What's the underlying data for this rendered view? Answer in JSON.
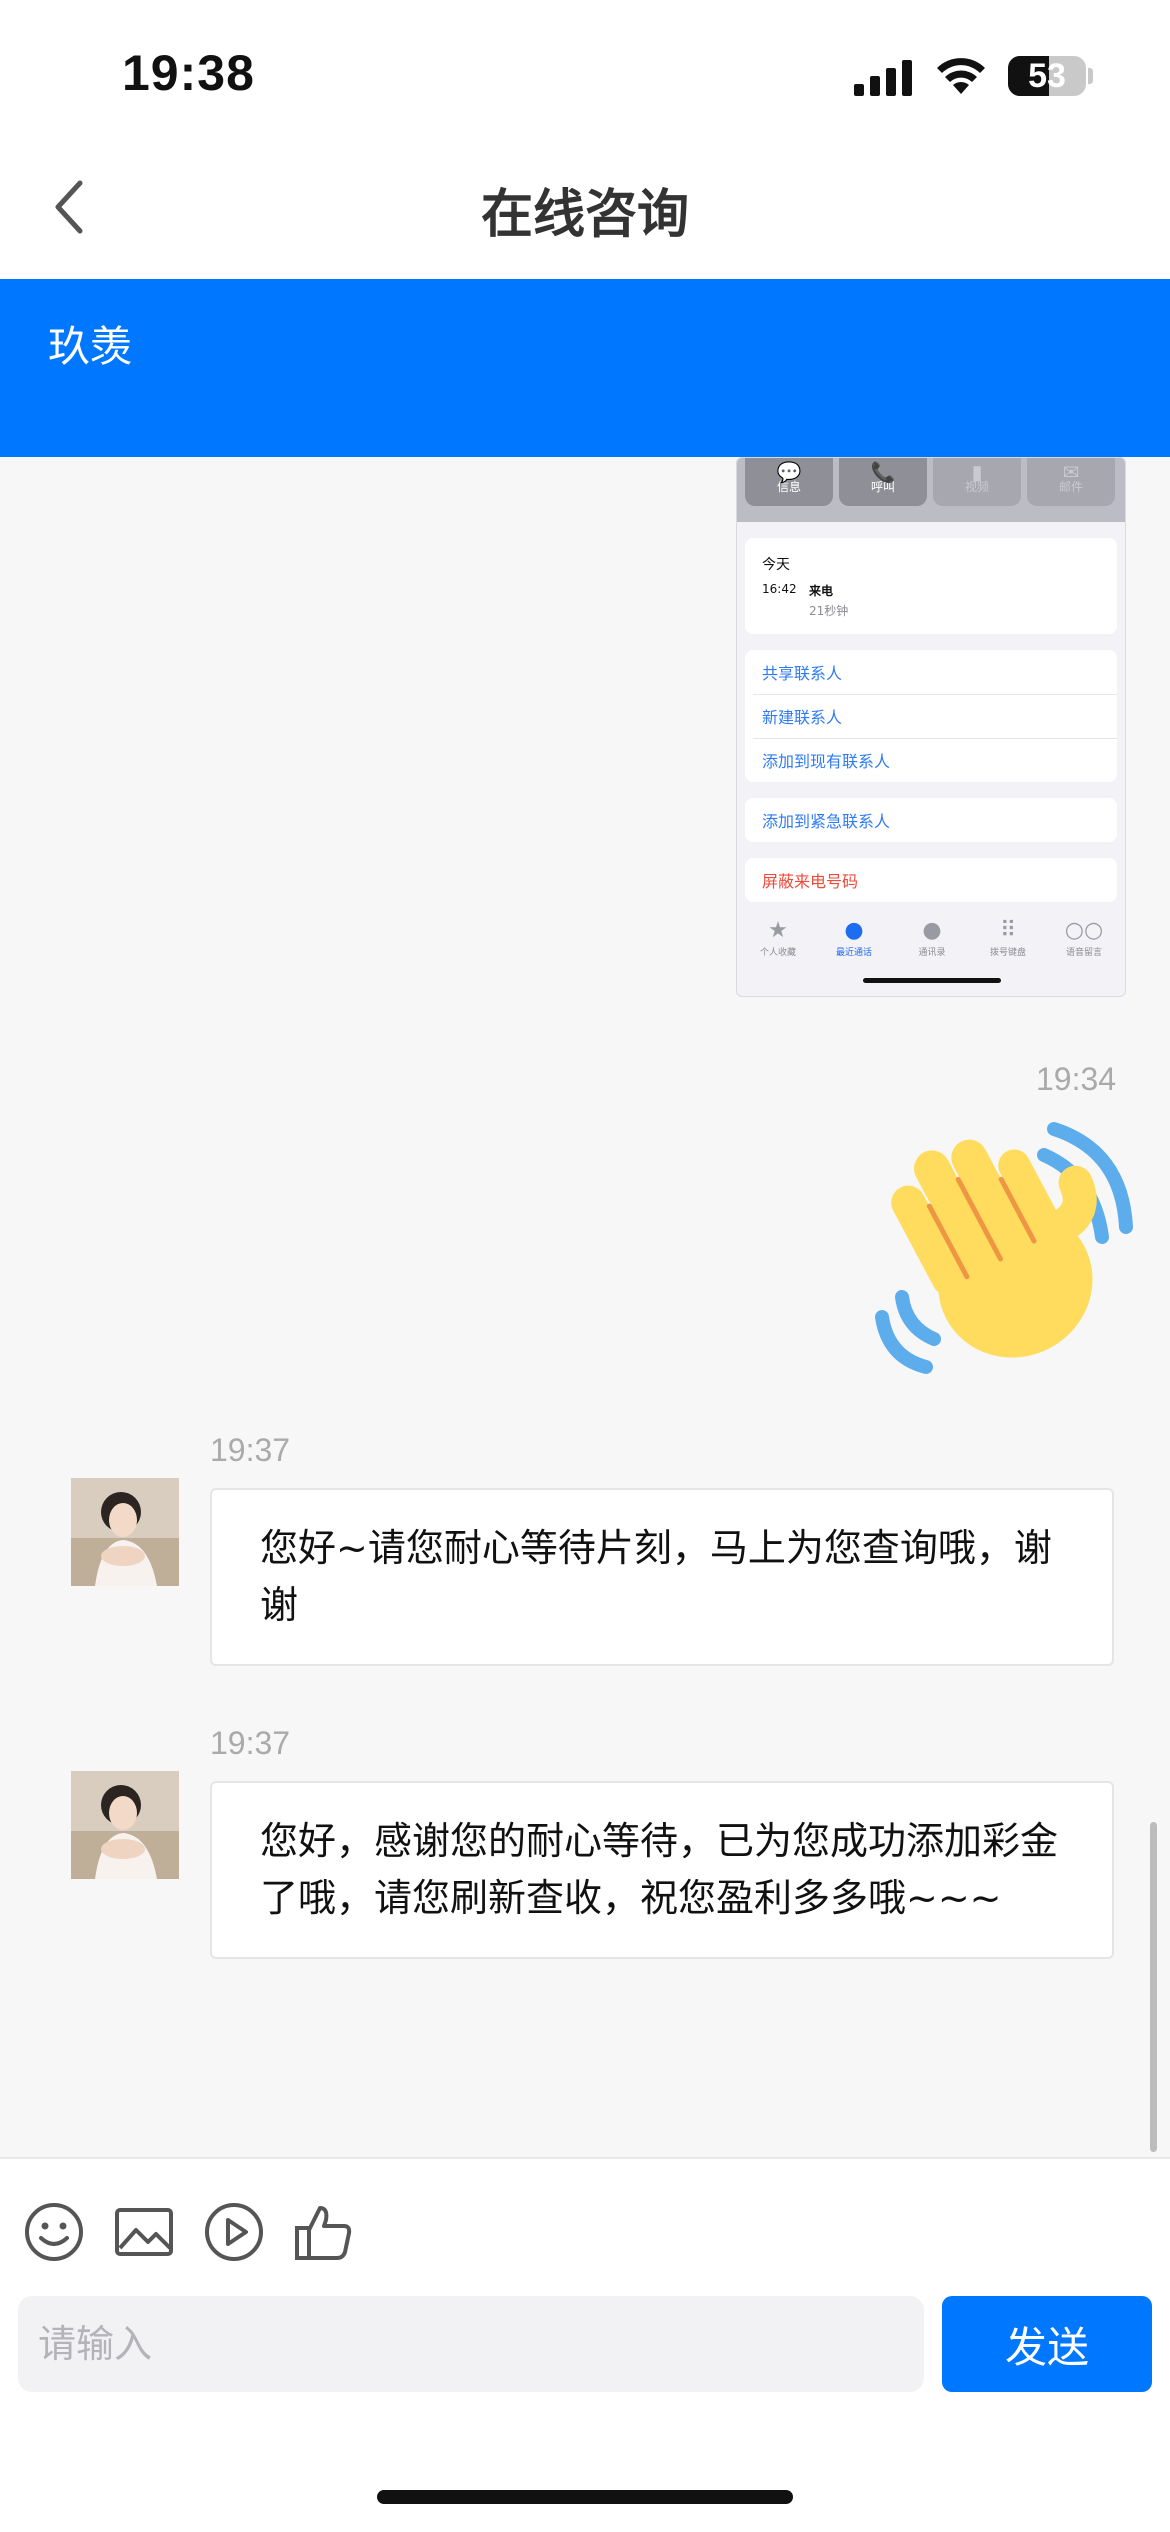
{
  "status_bar": {
    "time": "19:38",
    "battery": "53"
  },
  "header": {
    "title": "在线咨询",
    "back_icon": "chevron-left-icon"
  },
  "agent": {
    "name": "玖羡"
  },
  "screenshot_msg": {
    "actions": [
      {
        "label": "信息",
        "icon": "message-bubble-icon"
      },
      {
        "label": "呼叫",
        "icon": "phone-icon"
      },
      {
        "label": "视频",
        "icon": "video-icon"
      },
      {
        "label": "邮件",
        "icon": "mail-icon"
      }
    ],
    "recent": {
      "day": "今天",
      "time": "16:42",
      "type": "来电",
      "duration": "21秒钟"
    },
    "options": [
      "共享联系人",
      "新建联系人",
      "添加到现有联系人"
    ],
    "emergency": "添加到紧急联系人",
    "block": "屏蔽来电号码",
    "tabs": [
      "个人收藏",
      "最近通话",
      "通讯录",
      "拨号键盘",
      "语音留言"
    ]
  },
  "messages": [
    {
      "time": "19:34",
      "sender": "me",
      "emoji": "waving-hand"
    },
    {
      "time": "19:37",
      "sender": "agent",
      "text": "您好~请您耐心等待片刻，马上为您查询哦，谢谢"
    },
    {
      "time": "19:37",
      "sender": "agent",
      "text": "您好，感谢您的耐心等待，已为您成功添加彩金了哦，请您刷新查收，祝您盈利多多哦~~~"
    }
  ],
  "composer": {
    "placeholder": "请输入",
    "send_label": "发送",
    "tools": [
      "emoji-icon",
      "image-icon",
      "video-play-icon",
      "thumbs-up-icon"
    ]
  },
  "colors": {
    "accent": "#0077ff",
    "background": "#f7f7f8"
  }
}
